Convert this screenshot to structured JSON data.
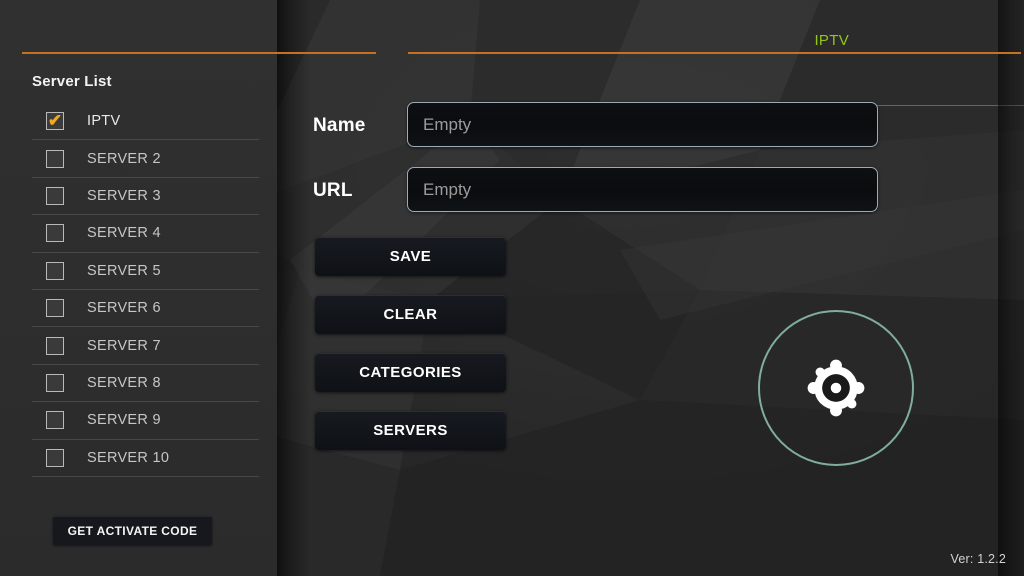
{
  "header": {
    "title": "IPTV",
    "accent_rule_color": "#c5711f",
    "title_color": "#93c61b"
  },
  "sidebar": {
    "title": "Server List",
    "checkbox_checked_color": "#f3a81f",
    "items": [
      {
        "label": "IPTV",
        "checked": true,
        "icon": "checkbox-checked-icon"
      },
      {
        "label": "SERVER 2",
        "checked": false,
        "icon": "checkbox-unchecked-icon"
      },
      {
        "label": "SERVER 3",
        "checked": false,
        "icon": "checkbox-unchecked-icon"
      },
      {
        "label": "SERVER 4",
        "checked": false,
        "icon": "checkbox-unchecked-icon"
      },
      {
        "label": "SERVER 5",
        "checked": false,
        "icon": "checkbox-unchecked-icon"
      },
      {
        "label": "SERVER 6",
        "checked": false,
        "icon": "checkbox-unchecked-icon"
      },
      {
        "label": "SERVER 7",
        "checked": false,
        "icon": "checkbox-unchecked-icon"
      },
      {
        "label": "SERVER 8",
        "checked": false,
        "icon": "checkbox-unchecked-icon"
      },
      {
        "label": "SERVER 9",
        "checked": false,
        "icon": "checkbox-unchecked-icon"
      },
      {
        "label": "SERVER 10",
        "checked": false,
        "icon": "checkbox-unchecked-icon"
      }
    ],
    "activate_button": "GET ACTIVATE CODE"
  },
  "form": {
    "name": {
      "label": "Name",
      "value": "",
      "placeholder": "Empty"
    },
    "url": {
      "label": "URL",
      "value": "",
      "placeholder": "Empty"
    }
  },
  "actions": {
    "save": "SAVE",
    "clear": "CLEAR",
    "categories": "CATEGORIES",
    "servers": "SERVERS"
  },
  "logo": {
    "icon": "target-gear-logo-icon",
    "ring_color": "#7fae9e"
  },
  "footer": {
    "version": "Ver: 1.2.2"
  }
}
